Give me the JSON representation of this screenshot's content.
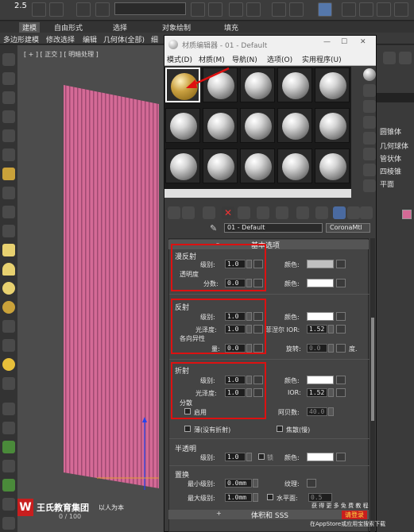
{
  "toolbar": {
    "zoom_value": "2.5"
  },
  "menubar": {
    "items": [
      "多边形建模",
      "修改选择",
      "编辑",
      "几何体(全部)",
      "细"
    ],
    "tabs": [
      "建模",
      "自由形式",
      "选择",
      "对象绘制",
      "填充"
    ]
  },
  "viewport": {
    "label": "[ + ] [ 正交 ] [ 明暗处理 ]"
  },
  "material_editor": {
    "title": "材质编辑器 - 01 - Default",
    "menus": [
      "模式(D)",
      "材质(M)",
      "导航(N)",
      "选项(O)",
      "实用程序(U)"
    ],
    "material_name": "01 - Default",
    "material_type": "CoronaMtl",
    "rollout_title": "基本选项",
    "diffuse": {
      "title": "漫反射",
      "level_label": "级别:",
      "level": "1.0",
      "color_label": "颜色:",
      "translucency_title": "透明度",
      "fraction_label": "分数:",
      "fraction": "0.0",
      "color_label_2": "颜色:",
      "color": "#c0c0c0",
      "color_2": "#ffffff"
    },
    "reflection": {
      "title": "反射",
      "level_label": "级别:",
      "level": "1.0",
      "color_label": "颜色:",
      "gloss_label": "光泽度:",
      "gloss": "1.0",
      "fresnel_label": "菲涅尔 IOR:",
      "fresnel": "1.52",
      "aniso_title": "各向异性",
      "amount_label": "量:",
      "amount": "0.0",
      "rotation_label": "旋转:",
      "rotation": "0.0",
      "degree_label": "度.",
      "color": "#ffffff"
    },
    "refraction": {
      "title": "折射",
      "level_label": "级别:",
      "level": "1.0",
      "color_label": "颜色:",
      "gloss_label": "光泽度:",
      "gloss": "1.0",
      "ior_label": "IOR:",
      "ior": "1.52",
      "dispersion_title": "分散",
      "enable_label": "启用",
      "abbe_label": "阿贝数:",
      "abbe": "40.0",
      "thin_label": "薄(没有折射)",
      "caustics_label": "焦散(慢)",
      "color": "#ffffff"
    },
    "translucency": {
      "title": "半透明",
      "level_label": "级别:",
      "level": "1.0",
      "color_label": "颜色:",
      "lock_label": "锁",
      "color": "#ffffff"
    },
    "displacement": {
      "title": "置换",
      "min_label": "最小级别:",
      "min": "0.0mm",
      "texture_label": "纹理:",
      "max_label": "最大级别:",
      "max": "1.0mm",
      "water_label": "水平面:",
      "water": "0.5"
    },
    "bottom_rollout": "体积和 SSS"
  },
  "command_panel": {
    "items": [
      "圆锥体",
      "几何球体",
      "管状体",
      "四棱锥",
      "平面"
    ]
  },
  "watermark": {
    "company": "王氏教育集团",
    "slogan": "以人为本",
    "right_top": "获 得 更 多 免 费 教 程",
    "right_mid": "请登录",
    "right_bottom": "在AppStore或应用宝搜索下载",
    "counter": "0 / 100"
  },
  "colors": {
    "accent_red": "#dd1111",
    "panel_bg": "#3a3a3a",
    "pink_object": "#d46a96"
  }
}
